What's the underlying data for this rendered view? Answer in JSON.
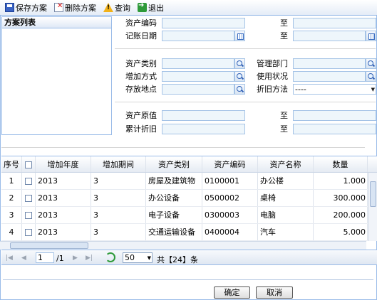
{
  "toolbar": {
    "save_label": "保存方案",
    "delete_label": "删除方案",
    "query_label": "查询",
    "exit_label": "退出"
  },
  "scheme_list": {
    "title": "方案列表"
  },
  "form": {
    "asset_code_label": "资产编码",
    "date_label": "记账日期",
    "to_label": "至",
    "category_label": "资产类别",
    "mgmt_dept_label": "管理部门",
    "add_method_label": "增加方式",
    "use_status_label": "使用状况",
    "location_label": "存放地点",
    "depr_method_label": "折旧方法",
    "depr_method_value": "----",
    "original_value_label": "资产原值",
    "accum_depr_label": "累计折旧"
  },
  "grid": {
    "columns": [
      "序号",
      "",
      "增加年度",
      "增加期间",
      "资产类别",
      "资产编码",
      "资产名称",
      "数量"
    ],
    "rows": [
      {
        "no": "1",
        "year": "2013",
        "period": "3",
        "category": "房屋及建筑物",
        "code": "0100001",
        "name": "办公楼",
        "qty": "1.000"
      },
      {
        "no": "2",
        "year": "2013",
        "period": "3",
        "category": "办公设备",
        "code": "0500002",
        "name": "桌椅",
        "qty": "300.000"
      },
      {
        "no": "3",
        "year": "2013",
        "period": "3",
        "category": "电子设备",
        "code": "0300003",
        "name": "电脑",
        "qty": "200.000"
      },
      {
        "no": "4",
        "year": "2013",
        "period": "3",
        "category": "交通运输设备",
        "code": "0400004",
        "name": "汽车",
        "qty": "5.000"
      }
    ]
  },
  "pager": {
    "page": "1",
    "of_pages": "/1",
    "page_size": "50",
    "total_text": "共【24】条"
  },
  "buttons": {
    "ok": "确定",
    "cancel": "取消"
  }
}
